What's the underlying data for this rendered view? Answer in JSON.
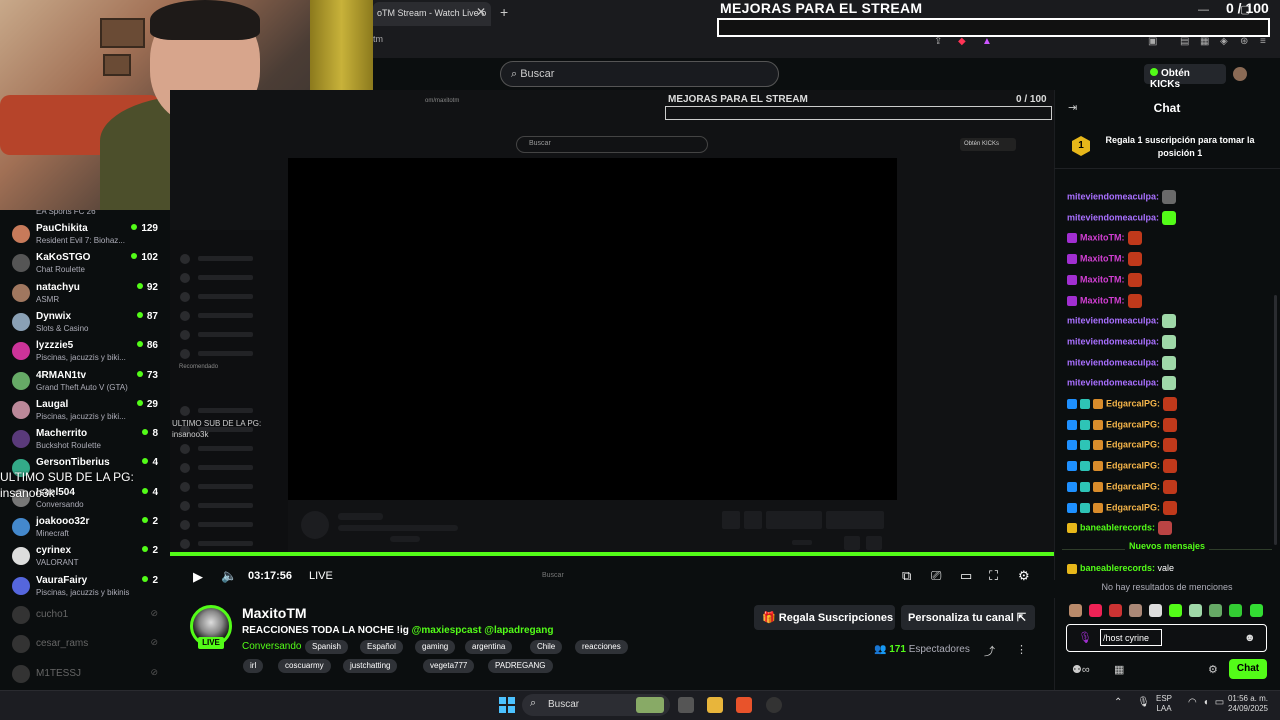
{
  "browser": {
    "tab_title": "oTM Stream - Watch Live o",
    "address_fragment": "tm",
    "overlay_title": "MEJORAS PARA EL STREAM",
    "overlay_count": "0 / 100"
  },
  "header": {
    "search_placeholder": "Buscar",
    "get_kicks_label": "Obtén KICKs"
  },
  "sidebar": {
    "first_sub": "EA Sports FC 26",
    "items": [
      {
        "name": "PauChikita",
        "sub": "Resident Evil 7: Biohaz...",
        "count": "129",
        "color": "#c77a5a"
      },
      {
        "name": "KaKoSTGO",
        "sub": "Chat Roulette",
        "count": "102",
        "color": "#555"
      },
      {
        "name": "natachyu",
        "sub": "ASMR",
        "count": "92",
        "color": "#a0775f"
      },
      {
        "name": "Dynwix",
        "sub": "Slots & Casino",
        "count": "87",
        "color": "#8aa0b5"
      },
      {
        "name": "lyzzzie5",
        "sub": "Piscinas, jacuzzis y biki...",
        "count": "86",
        "color": "#c39"
      },
      {
        "name": "4RMAN1tv",
        "sub": "Grand Theft Auto V (GTA)",
        "count": "73",
        "color": "#6a6"
      },
      {
        "name": "Laugal",
        "sub": "Piscinas, jacuzzis y biki...",
        "count": "29",
        "color": "#b89"
      },
      {
        "name": "Macherrito",
        "sub": "Buckshot Roulette",
        "count": "8",
        "color": "#5a3a7a"
      },
      {
        "name": "GersonTiberius",
        "sub": "",
        "count": "4",
        "color": "#3a8"
      },
      {
        "name": "Isael504",
        "sub": "Conversando",
        "count": "4",
        "color": "#777"
      },
      {
        "name": "joakooo32r",
        "sub": "Minecraft",
        "count": "2",
        "color": "#48c"
      },
      {
        "name": "cyrinex",
        "sub": "VALORANT",
        "count": "2",
        "color": "#ddd"
      },
      {
        "name": "VauraFairy",
        "sub": "Piscinas, jacuzzis y bikinis",
        "count": "2",
        "color": "#56d"
      }
    ],
    "offline": [
      "cucho1",
      "cesar_rams",
      "M1TESSJ"
    ],
    "overlay_ultimo": "ULTIMO SUB DE LA PG:",
    "overlay_user": "insanoo3k"
  },
  "player": {
    "inner_title": "MEJORAS PARA EL STREAM",
    "inner_count": "0 / 100",
    "inner_search": "Buscar",
    "inner_obt": "Obtén KICKs",
    "inner_recomendado": "Recomendado",
    "inner_ultimo": "ULTIMO SUB DE LA PG:",
    "inner_user": "insanoo3k",
    "inner_tab": "om/maxitotm",
    "inner_search2": "Buscar",
    "time": "03:17:56",
    "live": "LIVE"
  },
  "channel": {
    "name": "MaxitoTM",
    "live_badge": "LIVE",
    "title_text": "REACCIONES TODA LA NOCHE !ig",
    "mention1": "@maxiespcast",
    "mention2": "@lapadregang",
    "category": "Conversando",
    "tags": [
      "Spanish",
      "Español",
      "gaming",
      "argentina",
      "Chile",
      "reacciones",
      "irl",
      "coscuarmy",
      "justchatting",
      "vegeta777",
      "PADREGANG"
    ],
    "regala_label": "Regala Suscripciones",
    "personaliza_label": "Personaliza tu canal",
    "viewers_count": "171",
    "viewers_label": "Espectadores"
  },
  "chat": {
    "title": "Chat",
    "gift_rank": "1",
    "gift_text": "Regala 1 suscripción para tomar la posición 1",
    "messages": [
      {
        "user": "miteviendomeaculpa",
        "color": "#a970ff",
        "badges": [],
        "emote": "#6a6a6a"
      },
      {
        "user": "miteviendomeaculpa",
        "color": "#a970ff",
        "badges": [],
        "emote": "#53fc18"
      },
      {
        "user": "MaxitoTM",
        "color": "#d23fd3",
        "badges": [
          "#a12fd1"
        ],
        "emote": "#c0391b"
      },
      {
        "user": "MaxitoTM",
        "color": "#d23fd3",
        "badges": [
          "#a12fd1"
        ],
        "emote": "#c0391b"
      },
      {
        "user": "MaxitoTM",
        "color": "#d23fd3",
        "badges": [
          "#a12fd1"
        ],
        "emote": "#c0391b"
      },
      {
        "user": "MaxitoTM",
        "color": "#d23fd3",
        "badges": [
          "#a12fd1"
        ],
        "emote": "#c0391b"
      },
      {
        "user": "miteviendomeaculpa",
        "color": "#a970ff",
        "badges": [],
        "emote": "#9fd8a8"
      },
      {
        "user": "miteviendomeaculpa",
        "color": "#a970ff",
        "badges": [],
        "emote": "#9fd8a8"
      },
      {
        "user": "miteviendomeaculpa",
        "color": "#a970ff",
        "badges": [],
        "emote": "#9fd8a8"
      },
      {
        "user": "miteviendomeaculpa",
        "color": "#a970ff",
        "badges": [],
        "emote": "#9fd8a8"
      },
      {
        "user": "EdgarcalPG",
        "color": "#f5b54a",
        "badges": [
          "#1e90ff",
          "#2ec4b6",
          "#d98c2b"
        ],
        "emote": "#c0391b"
      },
      {
        "user": "EdgarcalPG",
        "color": "#f5b54a",
        "badges": [
          "#1e90ff",
          "#2ec4b6",
          "#d98c2b"
        ],
        "emote": "#c0391b"
      },
      {
        "user": "EdgarcalPG",
        "color": "#f5b54a",
        "badges": [
          "#1e90ff",
          "#2ec4b6",
          "#d98c2b"
        ],
        "emote": "#c0391b"
      },
      {
        "user": "EdgarcalPG",
        "color": "#f5b54a",
        "badges": [
          "#1e90ff",
          "#2ec4b6",
          "#d98c2b"
        ],
        "emote": "#c0391b"
      },
      {
        "user": "EdgarcalPG",
        "color": "#f5b54a",
        "badges": [
          "#1e90ff",
          "#2ec4b6",
          "#d98c2b"
        ],
        "emote": "#c0391b"
      },
      {
        "user": "EdgarcalPG",
        "color": "#f5b54a",
        "badges": [
          "#1e90ff",
          "#2ec4b6",
          "#d98c2b"
        ],
        "emote": "#c0391b"
      },
      {
        "user": "baneablerecords",
        "color": "#53fc18",
        "badges": [
          "#e7b71a"
        ],
        "emote": "#b44"
      }
    ],
    "new_messages_label": "Nuevos mensajes",
    "last_user": "baneablerecords",
    "last_text": "vale",
    "no_mentions": "No hay resultados de menciones",
    "input_value": "/host cyrine",
    "send_label": "Chat"
  },
  "taskbar": {
    "search_label": "Buscar",
    "lang_top": "ESP",
    "lang_bottom": "LAA",
    "time": "01:56 a. m.",
    "date": "24/09/2025"
  },
  "colors": {
    "accent": "#53fc18",
    "background": "#0b0e0f"
  }
}
